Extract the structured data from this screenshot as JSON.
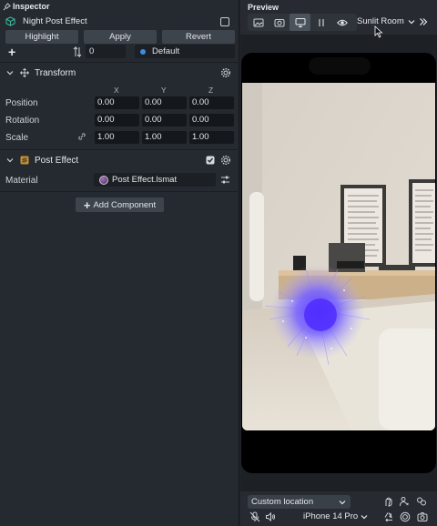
{
  "inspector": {
    "title": "Inspector",
    "object_name": "Night Post Effect",
    "buttons": {
      "highlight": "Highlight",
      "apply": "Apply",
      "revert": "Revert"
    },
    "render_order": "0",
    "layer": "Default",
    "transform": {
      "title": "Transform",
      "axes": [
        "X",
        "Y",
        "Z"
      ],
      "position_label": "Position",
      "rotation_label": "Rotation",
      "scale_label": "Scale",
      "position": [
        "0.00",
        "0.00",
        "0.00"
      ],
      "rotation": [
        "0.00",
        "0.00",
        "0.00"
      ],
      "scale": [
        "1.00",
        "1.00",
        "1.00"
      ]
    },
    "post_effect": {
      "title": "Post Effect",
      "material_label": "Material",
      "material_value": "Post Effect.lsmat"
    },
    "add_component": "Add Component"
  },
  "preview": {
    "title": "Preview",
    "scene": "Sunlit Room",
    "location": "Custom location",
    "device": "iPhone 14 Pro"
  },
  "colors": {
    "panel": "#252a31",
    "button": "#3d444c",
    "field": "#14171b",
    "accent_blue": "#3d8be0",
    "effect_purple": "#6a4dff"
  }
}
